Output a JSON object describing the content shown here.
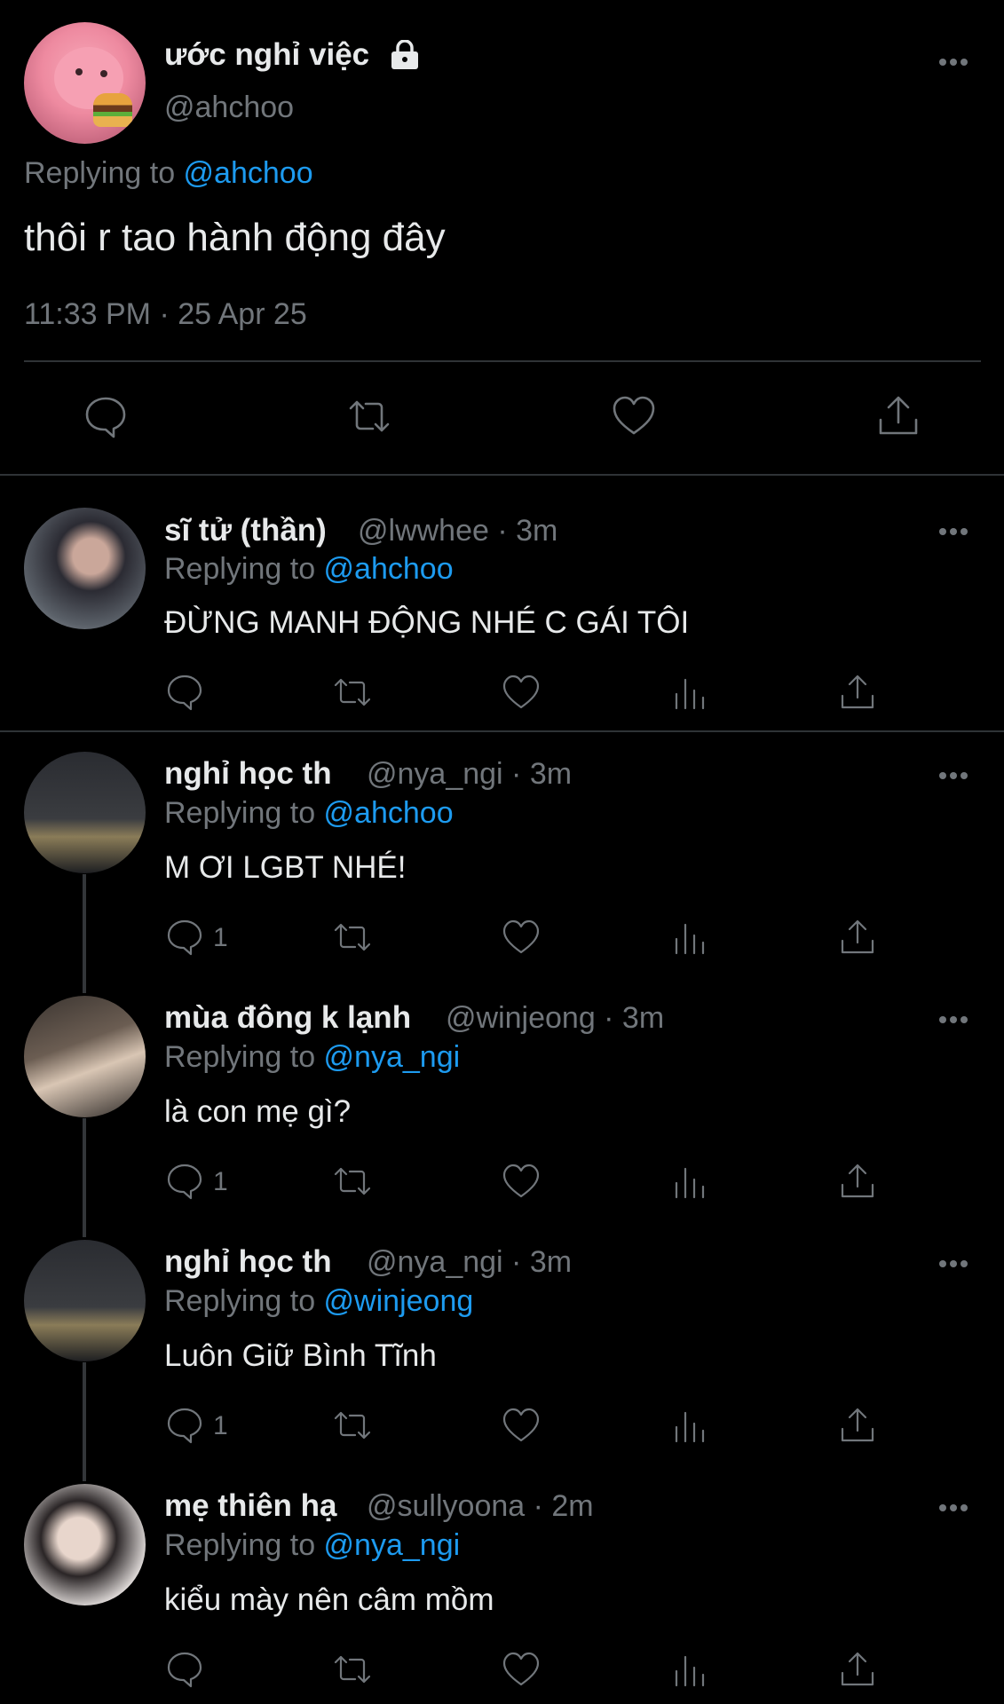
{
  "main": {
    "display_name": "ước nghỉ việc",
    "handle": "@ahchoo",
    "replying_prefix": "Replying to ",
    "replying_to": "@ahchoo",
    "text": "thôi r tao hành động đây",
    "timestamp": "11:33 PM · 25 Apr 25"
  },
  "replies": [
    {
      "name": "sĩ tử (thần)",
      "meta": "@lwwhee · 3m",
      "replying_to": "@ahchoo",
      "text": "ĐỪNG MANH ĐỘNG NHÉ C GÁI TÔI",
      "reply_count": ""
    },
    {
      "name": "nghỉ học th",
      "meta": "@nya_ngi · 3m",
      "replying_to": "@ahchoo",
      "text": "M ƠI LGBT NHÉ!",
      "reply_count": "1"
    },
    {
      "name": "mùa đông k lạnh",
      "meta": "@winjeong · 3m",
      "replying_to": "@nya_ngi",
      "text": "là con mẹ gì?",
      "reply_count": "1"
    },
    {
      "name": "nghỉ học th",
      "meta": "@nya_ngi · 3m",
      "replying_to": "@winjeong",
      "text": "Luôn Giữ Bình Tĩnh",
      "reply_count": "1"
    },
    {
      "name": "mẹ thiên hạ",
      "meta": "@sullyoona · 2m",
      "replying_to": "@nya_ngi",
      "text": "kiểu mày nên câm mồm",
      "reply_count": ""
    }
  ],
  "icons": {
    "reply": "reply-icon",
    "retweet": "retweet-icon",
    "like": "like-icon",
    "views": "views-icon",
    "share": "share-icon",
    "more": "more-icon",
    "lock": "lock-icon"
  },
  "colors": {
    "background": "#000000",
    "text": "#e7e9ea",
    "muted": "#71767b",
    "accent": "#1d9bf0",
    "divider": "#2f3336"
  }
}
